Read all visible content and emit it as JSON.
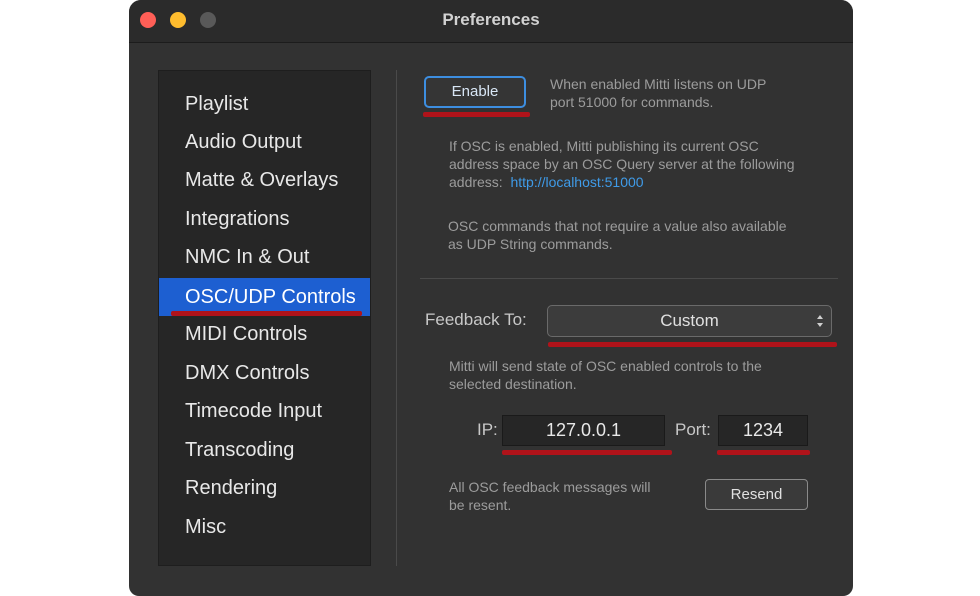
{
  "window": {
    "title": "Preferences"
  },
  "sidebar": {
    "items": [
      {
        "label": "Playlist"
      },
      {
        "label": "Audio Output"
      },
      {
        "label": "Matte & Overlays"
      },
      {
        "label": "Integrations"
      },
      {
        "label": "NMC In & Out"
      },
      {
        "label": "OSC/UDP Controls"
      },
      {
        "label": "MIDI Controls"
      },
      {
        "label": "DMX Controls"
      },
      {
        "label": "Timecode Input"
      },
      {
        "label": "Transcoding"
      },
      {
        "label": "Rendering"
      },
      {
        "label": "Misc"
      }
    ],
    "selected": "OSC/UDP Controls"
  },
  "osc": {
    "enable_label": "Enable",
    "enable_desc_line1": "When enabled Mitti listens on UDP",
    "enable_desc_line2": "port 51000 for commands.",
    "query_line1": "If OSC is enabled, Mitti publishing its current OSC",
    "query_line2": "address space by an OSC Query server at the following",
    "query_line3_prefix": "address:",
    "query_url": "http://localhost:51000",
    "udp_line1": "OSC commands that not require a value also available",
    "udp_line2": "as UDP String commands."
  },
  "feedback": {
    "label": "Feedback To:",
    "value": "Custom",
    "desc_line1": "Mitti will send state of OSC enabled controls to the",
    "desc_line2": "selected destination.",
    "ip_label": "IP:",
    "ip_value": "127.0.0.1",
    "port_label": "Port:",
    "port_value": "1234",
    "resend_desc_line1": "All OSC feedback messages will",
    "resend_desc_line2": "be resent.",
    "resend_label": "Resend"
  },
  "colors": {
    "selection": "#1d5fd1",
    "annotation_underline": "#b0131a",
    "link": "#3f9be8",
    "focus_ring": "#3d8ee0"
  }
}
